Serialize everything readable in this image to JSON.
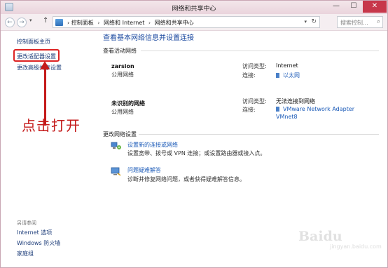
{
  "window": {
    "title": "网络和共享中心",
    "minimize": "—",
    "maximize": "☐",
    "close": "✕"
  },
  "nav": {
    "back": "←",
    "forward": "→",
    "up": "↑",
    "breadcrumbs": [
      "控制面板",
      "网络和 Internet",
      "网络和共享中心"
    ],
    "separator": "›",
    "search_placeholder": "搜索控制..."
  },
  "sidebar": {
    "items": [
      {
        "label": "控制面板主页"
      },
      {
        "label": "更改适配器设置"
      },
      {
        "label": "更改高级共享设置"
      }
    ],
    "see_also_title": "另请参阅",
    "see_also": [
      {
        "label": "Internet 选项"
      },
      {
        "label": "Windows 防火墙"
      },
      {
        "label": "家庭组"
      }
    ]
  },
  "annotation": {
    "text": "点击打开",
    "color": "#c41a1a"
  },
  "main": {
    "title": "查看基本网络信息并设置连接",
    "active_networks_header": "查看活动网络",
    "networks": [
      {
        "name": "zarsion",
        "type": "公用网络",
        "access_label": "访问类型:",
        "access_value": "Internet",
        "conn_label": "连接:",
        "conn_value": "以太网"
      },
      {
        "name": "未识别的网络",
        "type": "公用网络",
        "access_label": "访问类型:",
        "access_value": "无法连接到网络",
        "conn_label": "连接:",
        "conn_value": "VMware Network Adapter",
        "conn_value_2": "VMnet8"
      }
    ],
    "change_settings_header": "更改网络设置",
    "tasks": [
      {
        "link": "设置新的连接或网络",
        "desc": "设置宽带、拨号或 VPN 连接；或设置路由器或接入点。",
        "icon": "network-setup-icon"
      },
      {
        "link": "问题疑难解答",
        "desc": "诊断并修复网络问题，或者获得疑难解答信息。",
        "icon": "troubleshoot-icon"
      }
    ]
  },
  "watermark": {
    "logo": "Baidu",
    "sub": "jingyan.baidu.com"
  },
  "colors": {
    "link": "#1c5bb8",
    "close_button": "#c7374a",
    "accent_red": "#c41a1a"
  }
}
